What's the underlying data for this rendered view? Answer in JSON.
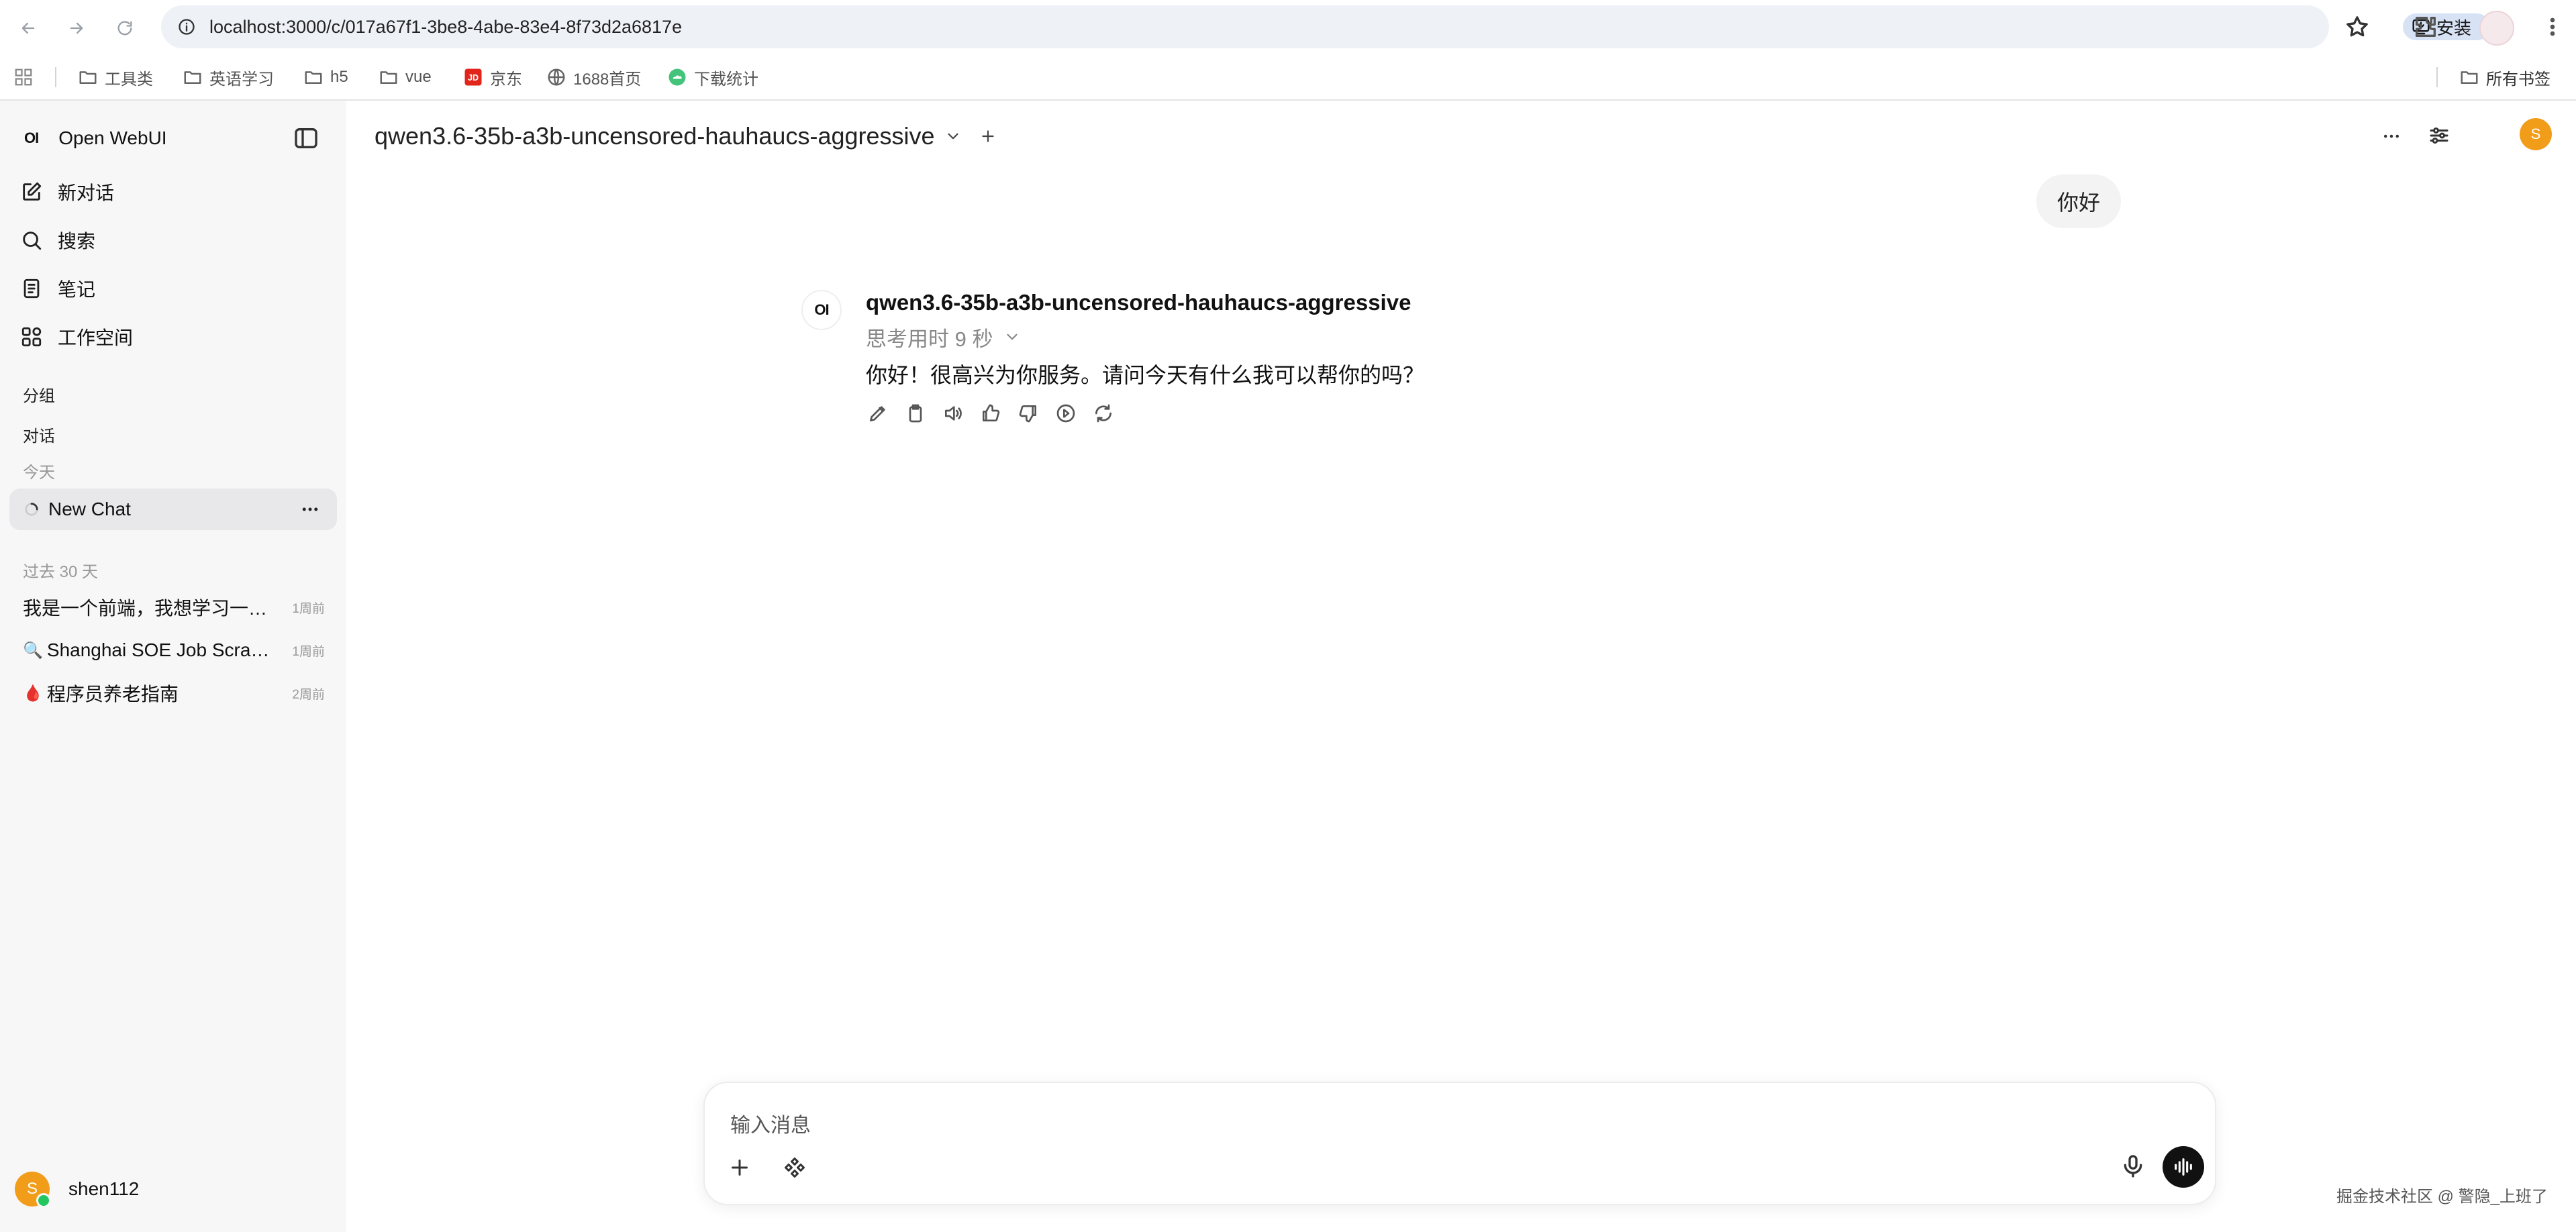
{
  "browser": {
    "url": "localhost:3000/c/017a67f1-3be8-4abe-83e4-8f73d2a6817e",
    "install_label": "安装"
  },
  "bookmarks": {
    "items": [
      {
        "label": "工具类",
        "icon": "folder-icon"
      },
      {
        "label": "英语学习",
        "icon": "folder-icon"
      },
      {
        "label": "h5",
        "icon": "folder-icon"
      },
      {
        "label": "vue",
        "icon": "folder-icon"
      },
      {
        "label": "京东",
        "icon": "jd-icon"
      },
      {
        "label": "1688首页",
        "icon": "globe-icon"
      },
      {
        "label": "下载统计",
        "icon": "cloud-icon"
      }
    ],
    "all_bookmarks_label": "所有书签"
  },
  "sidebar": {
    "brand_logo": "OI",
    "app_name": "Open WebUI",
    "nav": [
      {
        "label": "新对话",
        "icon": "new-chat-icon"
      },
      {
        "label": "搜索",
        "icon": "search-icon"
      },
      {
        "label": "笔记",
        "icon": "notes-icon"
      },
      {
        "label": "工作空间",
        "icon": "workspace-icon"
      }
    ],
    "section_groups": "分组",
    "section_chats": "对话",
    "section_today": "今天",
    "active_chat": "New Chat",
    "section_past30": "过去 30 天",
    "history": [
      {
        "emoji": "",
        "title": "我是一个前端，我想学习一…",
        "time": "1周前"
      },
      {
        "emoji": "🔍",
        "title": "Shanghai SOE Job Scrap…",
        "time": "1周前"
      },
      {
        "emoji": "🩸",
        "title": "程序员养老指南",
        "time": "2周前"
      }
    ],
    "user": {
      "initial": "S",
      "name": "shen112",
      "status_color": "#22c55e"
    }
  },
  "main": {
    "model_name": "qwen3.6-35b-a3b-uncensored-hauhaucs-aggressive",
    "top_avatar_initial": "S",
    "user_message": "你好",
    "assistant": {
      "avatar": "OI",
      "name": "qwen3.6-35b-a3b-uncensored-hauhaucs-aggressive",
      "thinking": "思考用时 9 秒",
      "message": "你好！很高兴为你服务。请问今天有什么我可以帮你的吗？"
    },
    "composer": {
      "placeholder": "输入消息"
    }
  },
  "watermark": "掘金技术社区 @ 警隐_上班了",
  "colors": {
    "accent_avatar": "#f29d1a",
    "voice_button": "#111111",
    "sidebar_bg": "#f7f7f8"
  }
}
